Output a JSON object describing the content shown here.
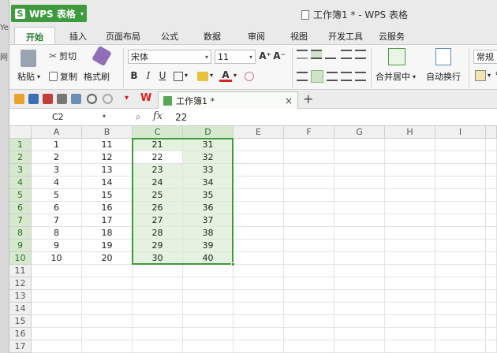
{
  "left_strip": {
    "texts": [
      "Ye",
      "网"
    ]
  },
  "app": {
    "name": "WPS 表格",
    "logo": "S",
    "dropdown": "▾"
  },
  "window": {
    "title": "工作簿1 * - WPS 表格"
  },
  "ribbon_tabs": [
    "开始",
    "插入",
    "页面布局",
    "公式",
    "数据",
    "审阅",
    "视图",
    "开发工具",
    "云服务"
  ],
  "ribbon": {
    "paste": "粘贴",
    "cut": "剪切",
    "copy": "复制",
    "format_painter": "格式刷",
    "font_name": "宋体",
    "font_size": "11",
    "merge_center": "合并居中",
    "wrap_text": "自动换行",
    "number_format": "常规",
    "percent": "%",
    "bold": "B",
    "italic": "I",
    "underline": "U",
    "grow_font": "A⁺",
    "shrink_font": "A⁻",
    "font_color": "A",
    "dropdown": "▾"
  },
  "doc_tab": {
    "label": "工作簿1 *",
    "close": "×",
    "add": "+"
  },
  "formula_bar": {
    "cell_ref": "C2",
    "fx": "fx",
    "zoom_icon": "⌕",
    "value": "22"
  },
  "columns": [
    "A",
    "B",
    "C",
    "D",
    "E",
    "F",
    "G",
    "H",
    "I"
  ],
  "rows": [
    "1",
    "2",
    "3",
    "4",
    "5",
    "6",
    "7",
    "8",
    "9",
    "10",
    "11",
    "12",
    "13",
    "14",
    "15",
    "16",
    "17"
  ],
  "cells": {
    "A": [
      "1",
      "2",
      "3",
      "4",
      "5",
      "6",
      "7",
      "8",
      "9",
      "10"
    ],
    "B": [
      "11",
      "12",
      "13",
      "14",
      "15",
      "16",
      "17",
      "18",
      "19",
      "20"
    ],
    "C": [
      "21",
      "22",
      "23",
      "24",
      "25",
      "26",
      "27",
      "28",
      "29",
      "30"
    ],
    "D": [
      "31",
      "32",
      "33",
      "34",
      "35",
      "36",
      "37",
      "38",
      "39",
      "40"
    ]
  },
  "selection": {
    "range": "C1:D10",
    "active": "C2"
  },
  "colors": {
    "accent": "#3d9a3d",
    "selection_fill": "#e4f2df",
    "header_selected": "#d6e9cf"
  }
}
